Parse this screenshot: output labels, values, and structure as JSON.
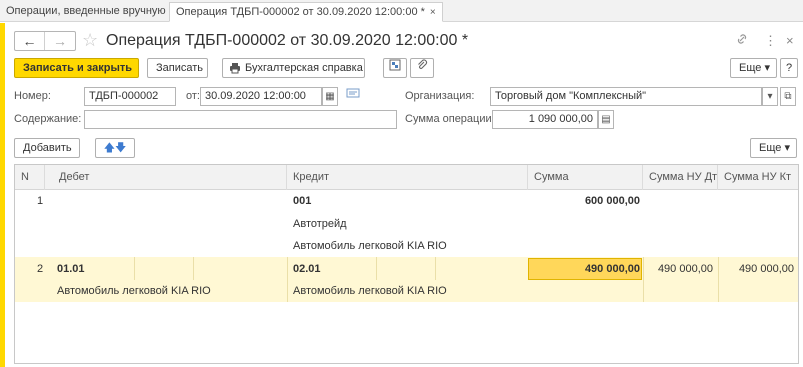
{
  "tabs": [
    {
      "label": "Операции, введенные вручную",
      "close": "×"
    },
    {
      "label": "Операция ТДБП-000002 от 30.09.2020 12:00:00 *",
      "close": "×"
    }
  ],
  "title": "Операция ТДБП-000002 от 30.09.2020 12:00:00 *",
  "nav": {
    "back": "←",
    "forward": "→"
  },
  "window_controls": {
    "link": "🔗",
    "more": "⋮",
    "close": "×"
  },
  "toolbar": {
    "save_close": "Записать и закрыть",
    "save": "Записать",
    "report": "Бухгалтерская справка",
    "more": "Еще ▾",
    "help": "?"
  },
  "form": {
    "number_label": "Номер:",
    "number_value": "ТДБП-000002",
    "date_label": "от:",
    "date_value": "30.09.2020 12:00:00",
    "org_label": "Организация:",
    "org_value": "Торговый дом \"Комплексный\"",
    "content_label": "Содержание:",
    "content_value": "",
    "sum_label": "Сумма операции:",
    "sum_value": "1 090 000,00"
  },
  "table_toolbar": {
    "add": "Добавить",
    "more": "Еще ▾"
  },
  "table": {
    "columns": [
      "N",
      "Дебет",
      "Кредит",
      "Сумма",
      "Сумма НУ Дт",
      "Сумма НУ Кт"
    ],
    "rows": [
      {
        "n": "1",
        "debit": "",
        "debit_sub": "",
        "credit": "001",
        "credit_sub1": "Автотрейд",
        "credit_sub2": "Автомобиль легковой KIA RIO",
        "sum": "600 000,00",
        "nu_dt": "",
        "nu_kt": ""
      },
      {
        "n": "2",
        "debit": "01.01",
        "debit_sub": "Автомобиль легковой KIA RIO",
        "credit": "02.01",
        "credit_sub1": "Автомобиль легковой KIA RIO",
        "credit_sub2": "",
        "sum": "490 000,00",
        "nu_dt": "490 000,00",
        "nu_kt": "490 000,00"
      }
    ]
  },
  "colors": {
    "accent": "#ffd800",
    "selected_row": "#fff8d4",
    "selected_cell": "#ffd75a"
  }
}
